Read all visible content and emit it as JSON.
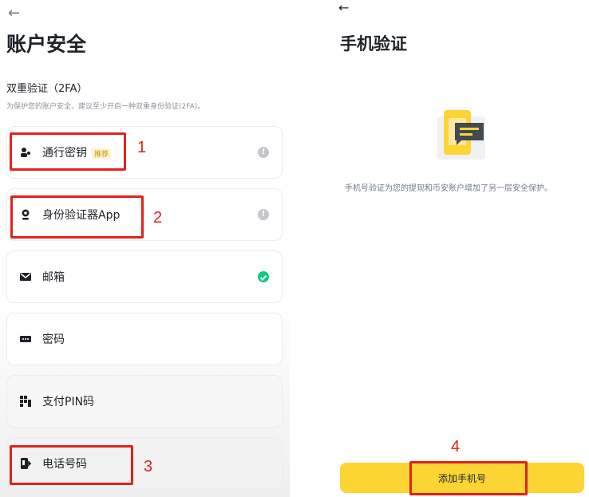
{
  "left": {
    "title": "账户安全",
    "section_title": "双重验证（2FA）",
    "section_desc": "为保护您的账户安全，建议至少开启一种双重身份验证(2FA)。",
    "items": [
      {
        "label": "通行密钥",
        "badge": "推荐",
        "icon": "passkey-icon",
        "status": "info"
      },
      {
        "label": "身份验证器App",
        "icon": "authenticator-icon",
        "status": "info"
      },
      {
        "label": "邮箱",
        "icon": "email-icon",
        "status": "verified"
      },
      {
        "label": "密码",
        "icon": "password-icon",
        "status": "none"
      },
      {
        "label": "支付PIN码",
        "icon": "pin-icon",
        "status": "none"
      },
      {
        "label": "电话号码",
        "icon": "phone-icon",
        "status": "none"
      }
    ]
  },
  "right": {
    "title": "手机验证",
    "description": "手机号验证为您的提现和币安账户增加了另一层安全保护。",
    "button_label": "添加手机号",
    "illustration": "phone-message-illustration"
  },
  "annotations": [
    "1",
    "2",
    "3",
    "4"
  ],
  "colors": {
    "accent": "#fcd535",
    "highlight": "#e2211c",
    "success": "#0ecb81"
  }
}
